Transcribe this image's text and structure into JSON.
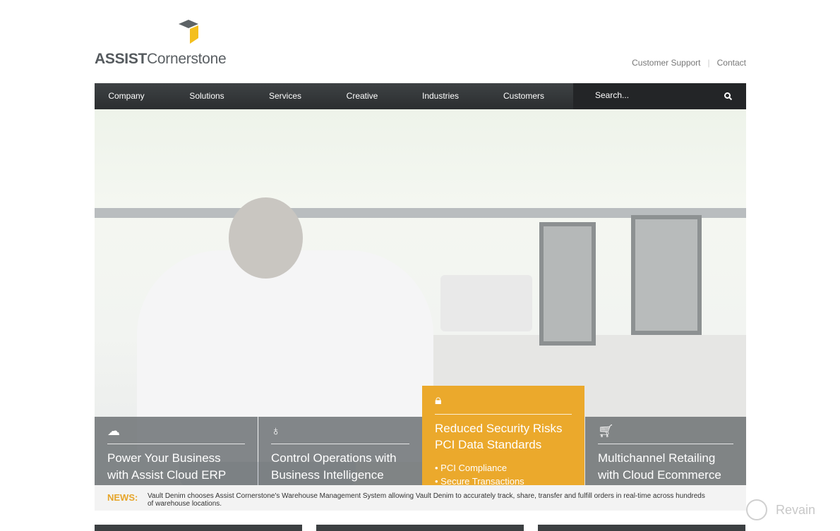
{
  "logo": {
    "bold": "ASSIST",
    "light": "Cornerstone"
  },
  "toplinks": [
    "Customer Support",
    "Contact"
  ],
  "nav": {
    "items": [
      "Company",
      "Solutions",
      "Services",
      "Creative",
      "Industries",
      "Customers"
    ],
    "search_placeholder": "Search..."
  },
  "tiles": [
    {
      "icon": "cloud-icon",
      "title": [
        "Power Your Business",
        "with Assist Cloud ERP"
      ]
    },
    {
      "icon": "lightbulb-icon",
      "title": [
        "Control Operations with",
        "Business Intelligence"
      ]
    },
    {
      "icon": "shopping-cart-icon",
      "title": [
        "Multichannel Retailing",
        "with Cloud Ecommerce"
      ]
    }
  ],
  "featured": {
    "icon": "lock-icon",
    "title": [
      "Reduced Security Risks",
      "PCI Data Standards"
    ],
    "bullets": [
      "• PCI Compliance",
      "• Secure Transactions"
    ],
    "color": "#EBA92C"
  },
  "news": {
    "label": "NEWS:",
    "text": "Vault Denim chooses Assist Cornerstone's Warehouse Management System allowing Vault Denim to accurately track, share, transfer and fulfill orders in real-time across hundreds of warehouse locations."
  },
  "watermark": "Revain"
}
